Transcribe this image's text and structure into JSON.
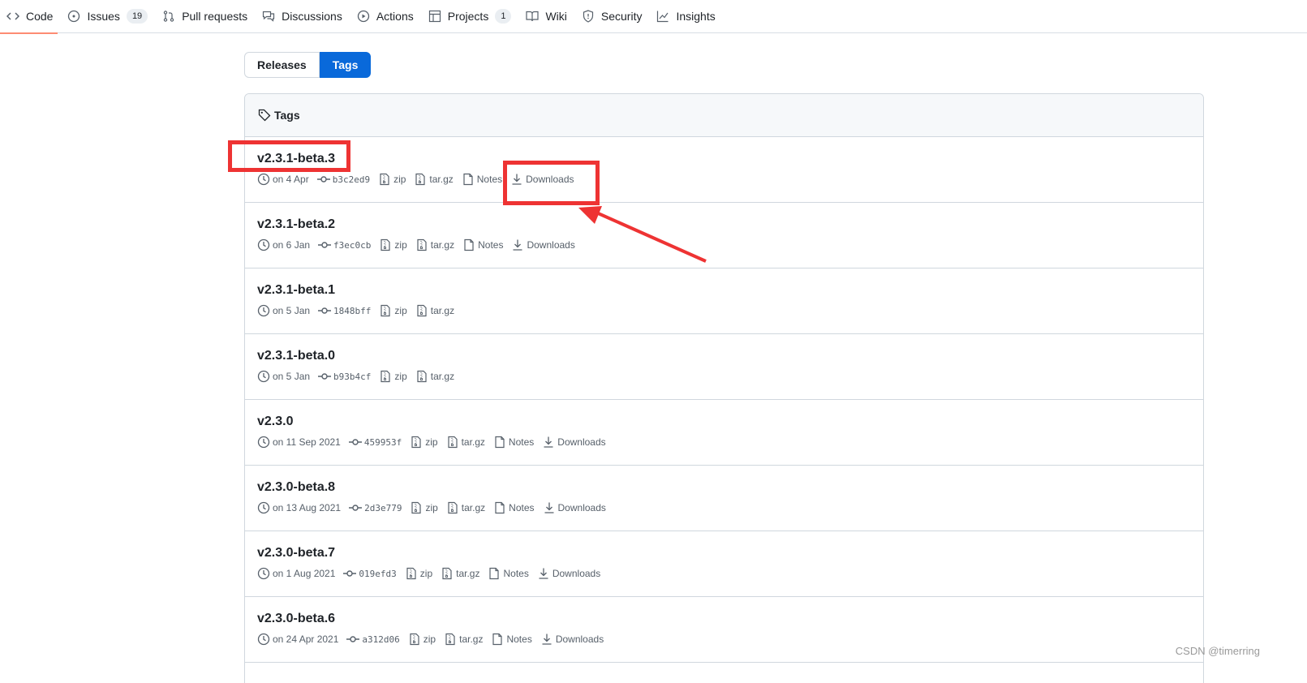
{
  "nav": {
    "items": [
      {
        "label": "Code",
        "icon": "code-icon",
        "selected": true
      },
      {
        "label": "Issues",
        "icon": "issue-icon",
        "count": "19"
      },
      {
        "label": "Pull requests",
        "icon": "pull-request-icon"
      },
      {
        "label": "Discussions",
        "icon": "discussion-icon"
      },
      {
        "label": "Actions",
        "icon": "play-icon"
      },
      {
        "label": "Projects",
        "icon": "table-icon",
        "count": "1"
      },
      {
        "label": "Wiki",
        "icon": "book-icon"
      },
      {
        "label": "Security",
        "icon": "shield-icon"
      },
      {
        "label": "Insights",
        "icon": "graph-icon"
      }
    ]
  },
  "toggle": {
    "releases": "Releases",
    "tags": "Tags"
  },
  "box": {
    "title": "Tags"
  },
  "tags": [
    {
      "name": "v2.3.1-beta.3",
      "date": "on 4 Apr",
      "sha": "b3c2ed9",
      "zip": "zip",
      "targz": "tar.gz",
      "notes": "Notes",
      "downloads": "Downloads"
    },
    {
      "name": "v2.3.1-beta.2",
      "date": "on 6 Jan",
      "sha": "f3ec0cb",
      "zip": "zip",
      "targz": "tar.gz",
      "notes": "Notes",
      "downloads": "Downloads"
    },
    {
      "name": "v2.3.1-beta.1",
      "date": "on 5 Jan",
      "sha": "1848bff",
      "zip": "zip",
      "targz": "tar.gz"
    },
    {
      "name": "v2.3.1-beta.0",
      "date": "on 5 Jan",
      "sha": "b93b4cf",
      "zip": "zip",
      "targz": "tar.gz"
    },
    {
      "name": "v2.3.0",
      "date": "on 11 Sep 2021",
      "sha": "459953f",
      "zip": "zip",
      "targz": "tar.gz",
      "notes": "Notes",
      "downloads": "Downloads"
    },
    {
      "name": "v2.3.0-beta.8",
      "date": "on 13 Aug 2021",
      "sha": "2d3e779",
      "zip": "zip",
      "targz": "tar.gz",
      "notes": "Notes",
      "downloads": "Downloads"
    },
    {
      "name": "v2.3.0-beta.7",
      "date": "on 1 Aug 2021",
      "sha": "019efd3",
      "zip": "zip",
      "targz": "tar.gz",
      "notes": "Notes",
      "downloads": "Downloads"
    },
    {
      "name": "v2.3.0-beta.6",
      "date": "on 24 Apr 2021",
      "sha": "a312d06",
      "zip": "zip",
      "targz": "tar.gz",
      "notes": "Notes",
      "downloads": "Downloads"
    }
  ],
  "watermark": "CSDN @timerring",
  "colors": {
    "accent": "#0969da",
    "annotation": "#ee3333",
    "selected_underline": "#fd8c73"
  }
}
